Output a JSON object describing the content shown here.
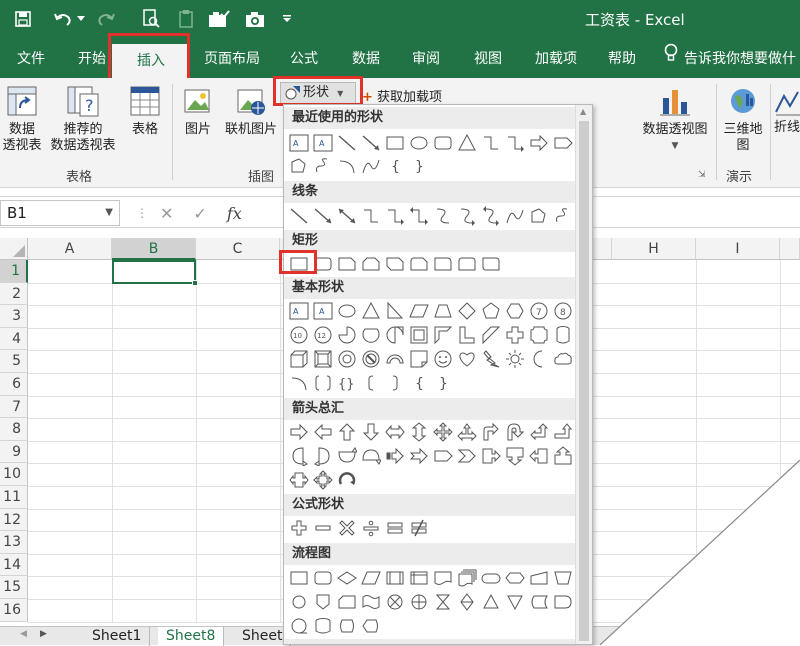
{
  "window": {
    "title": "工资表 - Excel"
  },
  "qat": {
    "icons": [
      "save-icon",
      "undo-icon",
      "redo-icon",
      "print-preview-icon",
      "clipboard-icon",
      "camera-check-icon",
      "camera-icon",
      "customize-icon"
    ]
  },
  "tabs": [
    {
      "id": "file",
      "label": "文件"
    },
    {
      "id": "home",
      "label": "开始"
    },
    {
      "id": "insert",
      "label": "插入"
    },
    {
      "id": "layout",
      "label": "页面布局"
    },
    {
      "id": "formula",
      "label": "公式"
    },
    {
      "id": "data",
      "label": "数据"
    },
    {
      "id": "review",
      "label": "审阅"
    },
    {
      "id": "view",
      "label": "视图"
    },
    {
      "id": "addins",
      "label": "加载项"
    },
    {
      "id": "help",
      "label": "帮助"
    },
    {
      "id": "tellme",
      "label": "告诉我你想要做什"
    }
  ],
  "ribbon": {
    "pivot_line1": "数据",
    "pivot_line2": "透视表",
    "rec_line1": "推荐的",
    "rec_line2": "数据透视表",
    "table": "表格",
    "picture": "图片",
    "online_picture": "联机图片",
    "shapes_label": "形状",
    "get_addins": "获取加载项",
    "pivot_chart": "数据透视图",
    "map3d_line1": "三维地",
    "map3d_line2": "图",
    "sparkline": "折线",
    "group_tables": "表格",
    "group_illustrations": "插图",
    "group_tours": "演示"
  },
  "formula_bar": {
    "name_box": "B1",
    "fx": "fx"
  },
  "grid": {
    "columns": [
      "A",
      "B",
      "C",
      "H",
      "I"
    ],
    "rows": [
      "1",
      "2",
      "3",
      "4",
      "5",
      "6",
      "7",
      "8",
      "9",
      "10",
      "11",
      "12",
      "13",
      "14",
      "15",
      "16"
    ],
    "selected_col": "B",
    "selected_row": "1"
  },
  "sheets": [
    "Sheet1",
    "Sheet8",
    "Sheet"
  ],
  "active_sheet": "Sheet8",
  "shapes_menu": {
    "sections": [
      {
        "id": "recent",
        "title": "最近使用的形状"
      },
      {
        "id": "lines",
        "title": "线条"
      },
      {
        "id": "rect",
        "title": "矩形"
      },
      {
        "id": "basic",
        "title": "基本形状"
      },
      {
        "id": "arrows",
        "title": "箭头总汇"
      },
      {
        "id": "equation",
        "title": "公式形状"
      },
      {
        "id": "flowchart",
        "title": "流程图"
      }
    ]
  },
  "colors": {
    "excel_green": "#217346",
    "highlight_red": "#e0322a"
  }
}
